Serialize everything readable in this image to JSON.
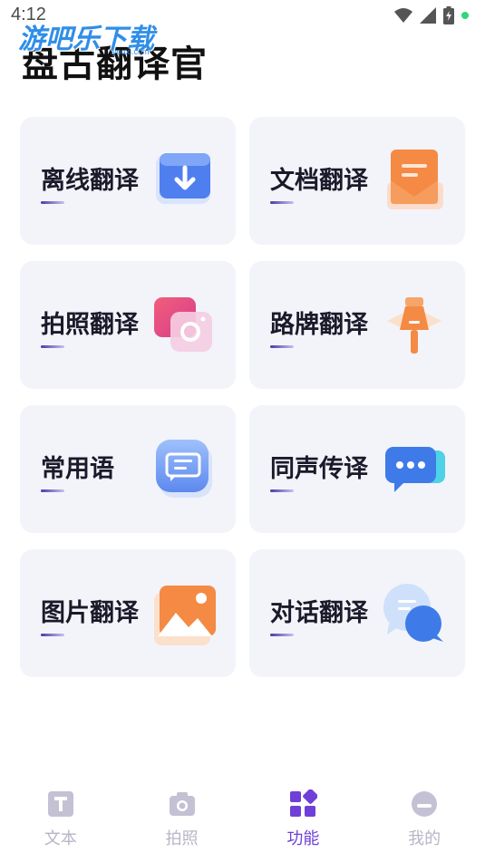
{
  "status_bar": {
    "time": "4:12"
  },
  "watermark": {
    "text": "游吧乐下载",
    "sub": "youxi.com"
  },
  "app": {
    "title": "盘古翻译官"
  },
  "features": [
    {
      "label": "离线翻译",
      "icon": "download-icon"
    },
    {
      "label": "文档翻译",
      "icon": "document-mail-icon"
    },
    {
      "label": "拍照翻译",
      "icon": "camera-icon"
    },
    {
      "label": "路牌翻译",
      "icon": "signpost-icon"
    },
    {
      "label": "常用语",
      "icon": "phrase-book-icon"
    },
    {
      "label": "同声传译",
      "icon": "chat-bubble-icon"
    },
    {
      "label": "图片翻译",
      "icon": "image-icon"
    },
    {
      "label": "对话翻译",
      "icon": "conversation-icon"
    }
  ],
  "nav": {
    "items": [
      {
        "label": "文本",
        "icon": "text-icon",
        "active": false
      },
      {
        "label": "拍照",
        "icon": "camera-icon",
        "active": false
      },
      {
        "label": "功能",
        "icon": "grid-icon",
        "active": true
      },
      {
        "label": "我的",
        "icon": "profile-icon",
        "active": false
      }
    ]
  },
  "colors": {
    "accent": "#6f3fd8",
    "card_bg": "#f2f4f9",
    "nav_inactive": "#b8b5c8"
  }
}
